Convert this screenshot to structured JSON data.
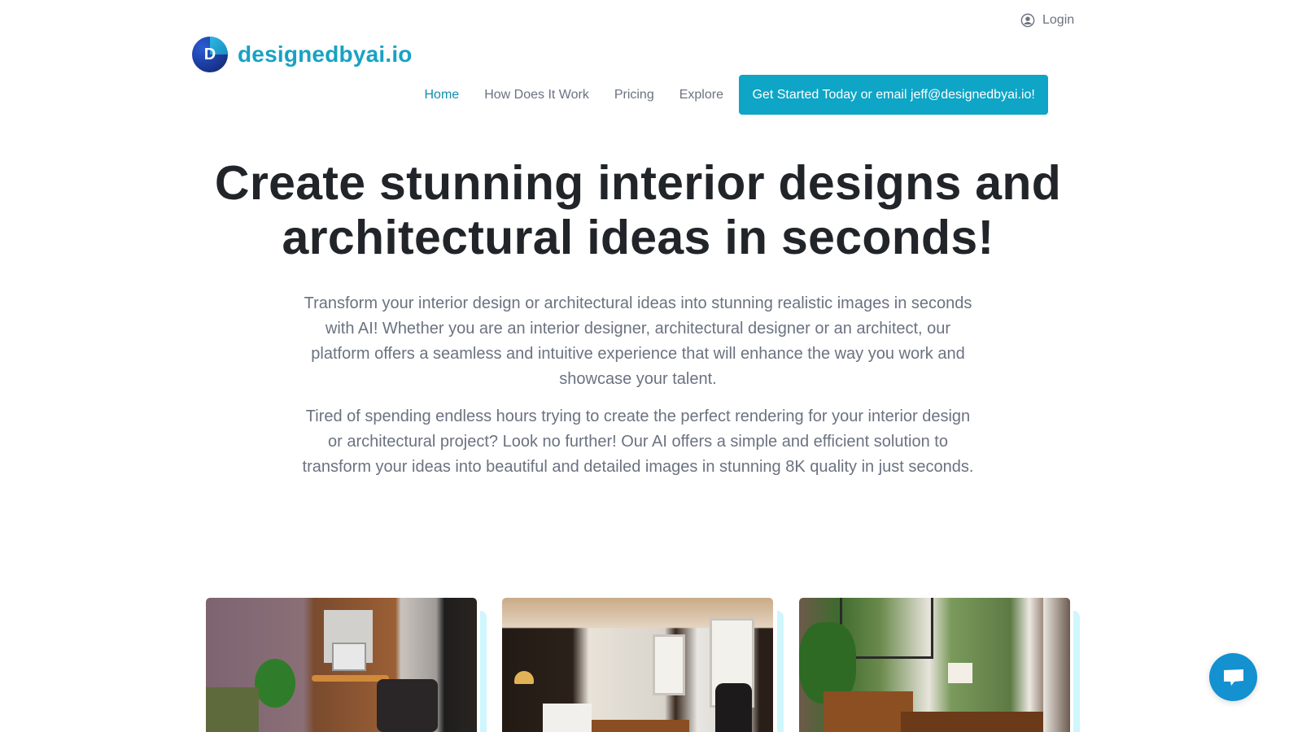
{
  "header": {
    "login_label": "Login",
    "login_icon": "user-circle-icon",
    "logo_letter": "D",
    "logo_text": "designedbyai.io",
    "nav": [
      {
        "label": "Home",
        "active": true
      },
      {
        "label": "How Does It Work",
        "active": false
      },
      {
        "label": "Pricing",
        "active": false
      },
      {
        "label": "Explore",
        "active": false
      }
    ],
    "cta_label": "Get Started Today or email jeff@designedbyai.io!"
  },
  "hero": {
    "title_line1": "Create stunning interior designs and",
    "title_line2": "architectural ideas in seconds!",
    "paragraph1": "Transform your interior design or architectural ideas into stunning realistic images in seconds with AI! Whether you are an interior designer, architectural designer or an architect, our platform offers a seamless and intuitive experience that will enhance the way you work and showcase your talent.",
    "paragraph2": "Tired of spending endless hours trying to create the perfect rendering for your interior design or architectural project? Look no further! Our AI offers a simple and efficient solution to transform your ideas into beautiful and detailed images in stunning 8K quality in just seconds."
  },
  "gallery": [
    {
      "alt": "Office interior with wood panel wall, computer desk and bookshelf"
    },
    {
      "alt": "Luxury office with dark curtains, tall windows and desk"
    },
    {
      "alt": "Office with large windows overlooking trees, desk and lamp"
    }
  ],
  "chat": {
    "icon": "chat-bubble-icon"
  },
  "colors": {
    "brand": "#17a2c4",
    "cta_bg": "#0ea5c6",
    "nav_active": "#0e8fad",
    "text_muted": "#6b7280",
    "chat_bg": "#1391d0"
  }
}
